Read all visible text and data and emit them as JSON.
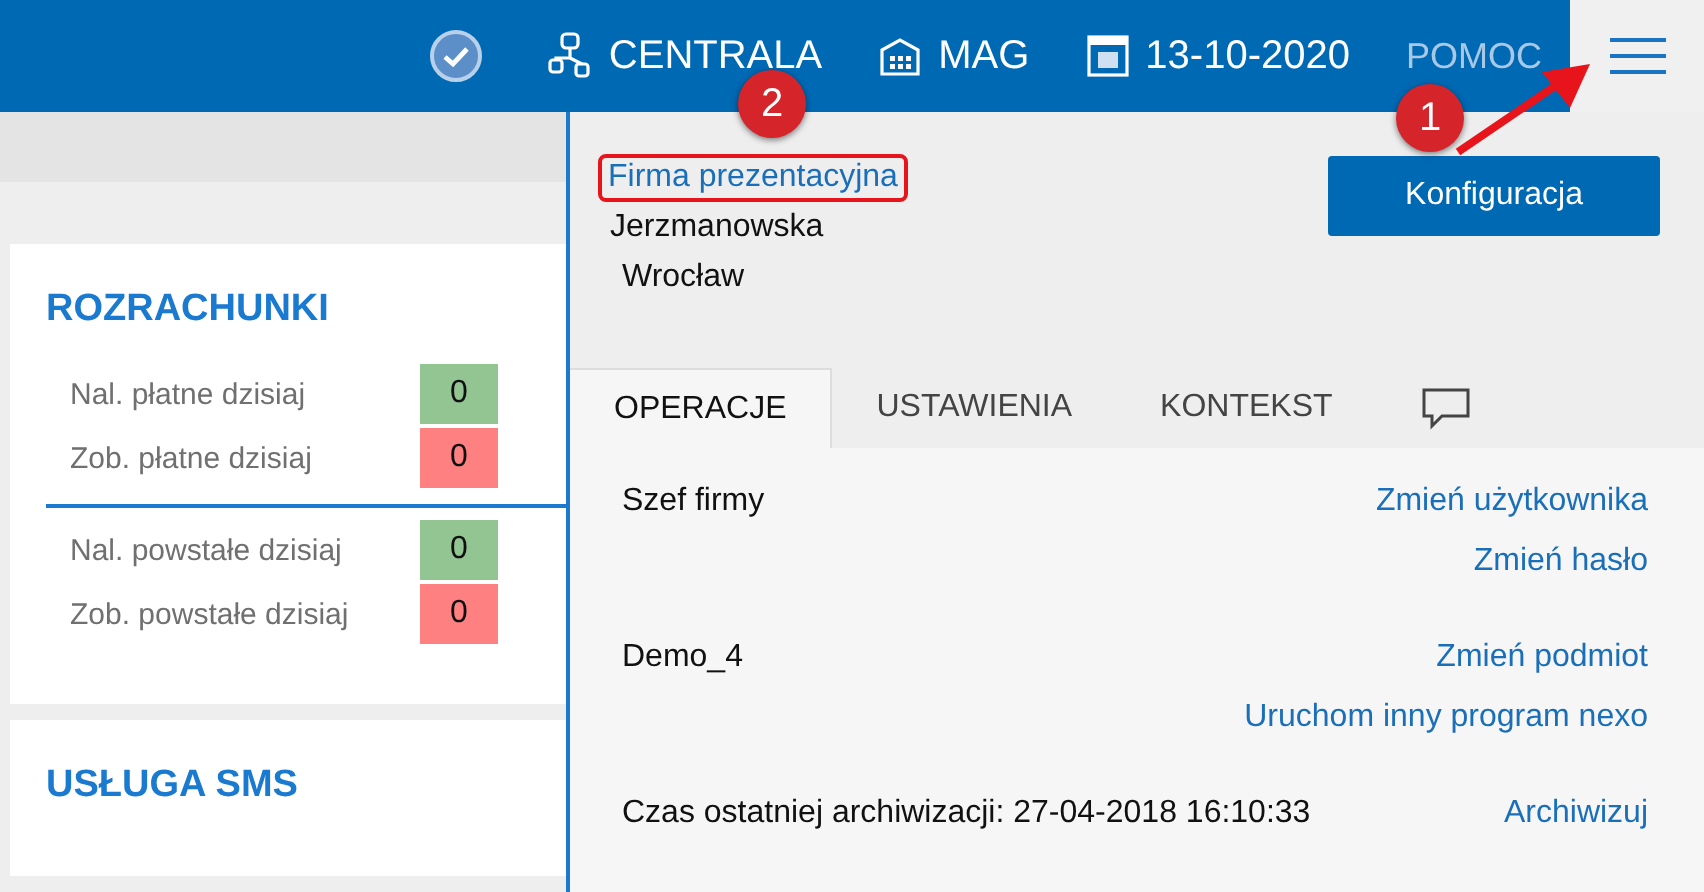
{
  "top_bar": {
    "items": [
      {
        "kind": "status"
      },
      {
        "kind": "branch",
        "label": "CENTRALA"
      },
      {
        "kind": "warehouse",
        "label": "MAG"
      },
      {
        "kind": "date",
        "label": "13-10-2020"
      },
      {
        "kind": "help",
        "label": "POMOC"
      }
    ]
  },
  "cards": [
    {
      "title": "ROZRACHUNKI",
      "groups": [
        [
          {
            "label": "Nal. płatne dzisiaj",
            "value": "0",
            "color": "#93c593"
          },
          {
            "label": "Zob. płatne dzisiaj",
            "value": "0",
            "color": "#ff8080"
          }
        ],
        [
          {
            "label": "Nal. powstałe dzisiaj",
            "value": "0",
            "color": "#93c593"
          },
          {
            "label": "Zob. powstałe dzisiaj",
            "value": "0",
            "color": "#ff8080"
          }
        ]
      ]
    },
    {
      "title": "USŁUGA SMS"
    }
  ],
  "panel": {
    "company_link": "Firma prezentacyjna",
    "street": "Jerzmanowska",
    "city": "Wrocław",
    "config_button": "Konfiguracja",
    "tabs": [
      {
        "label": "OPERACJE",
        "selected": true
      },
      {
        "label": "USTAWIENIA",
        "selected": false
      },
      {
        "label": "KONTEKST",
        "selected": false
      },
      {
        "kind": "chat",
        "selected": false
      }
    ],
    "sections": [
      {
        "label": "Szef firmy",
        "links": [
          "Zmień użytkownika",
          "Zmień hasło"
        ]
      },
      {
        "label": "Demo_4",
        "links": [
          "Zmień podmiot",
          "Uruchom inny program nexo"
        ]
      },
      {
        "label": "Czas ostatniej archiwizacji: 27-04-2018 16:10:33",
        "links": [
          "Archiwizuj"
        ]
      }
    ]
  },
  "annotations": [
    {
      "number": "2"
    },
    {
      "number": "1"
    }
  ]
}
